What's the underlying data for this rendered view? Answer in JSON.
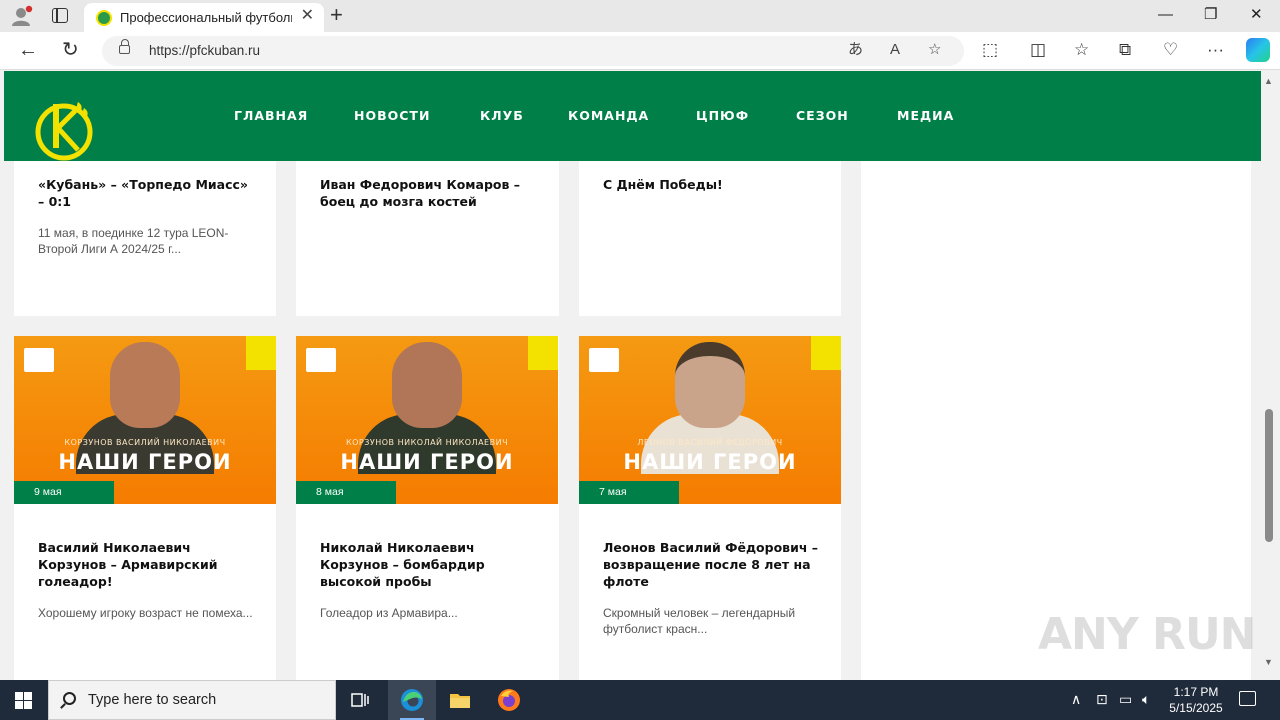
{
  "browser": {
    "tab_title": "Профессиональный футбольный клуб «Кубань»",
    "url": "https://pfckuban.ru"
  },
  "site": {
    "nav": [
      "ГЛАВНАЯ",
      "НОВОСТИ",
      "КЛУБ",
      "КОМАНДА",
      "ЦПЮФ",
      "СЕЗОН",
      "МЕДИА"
    ],
    "logo_text": "КУБАНЬ",
    "colors": {
      "brand_green": "#008048",
      "banner_orange": "#f57c00",
      "logo_yellow": "#f3e100"
    }
  },
  "news_row1": [
    {
      "title": "«Кубань» – «Торпедо Миасс» – 0:1",
      "excerpt": "11 мая, в поединке 12 тура LEON-Второй Лиги А 2024/25 г..."
    },
    {
      "title": "Иван Федорович Комаров – боец до мозга костей",
      "excerpt": ""
    },
    {
      "title": "С Днём Победы!",
      "excerpt": ""
    }
  ],
  "news_row2": [
    {
      "banner_name": "КОРЗУНОВ ВАСИЛИЙ НИКОЛАЕВИЧ",
      "banner_heading": "НАШИ ГЕРОИ",
      "date": "9 мая",
      "title": "Василий Николаевич Корзунов – Армавирский голеадор!",
      "excerpt": "Хорошему игроку возраст не помеха..."
    },
    {
      "banner_name": "КОРЗУНОВ НИКОЛАЙ НИКОЛАЕВИЧ",
      "banner_heading": "НАШИ ГЕРОИ",
      "date": "8 мая",
      "title": "Николай Николаевич Корзунов – бомбардир высокой пробы",
      "excerpt": "Голеадор из Армавира..."
    },
    {
      "banner_name": "ЛЕОНОВ ВАСИЛИЙ ФЕДОРОВИЧ",
      "banner_heading": "НАШИ ГЕРОИ",
      "date": "7 мая",
      "title": "Леонов Василий Фёдорович – возвращение после 8 лет на флоте",
      "excerpt": "Скромный человек – легендарный футболист красн..."
    }
  ],
  "watermark": "ANY RUN",
  "taskbar": {
    "search_placeholder": "Type here to search",
    "time": "1:17 PM",
    "date": "5/15/2025"
  }
}
